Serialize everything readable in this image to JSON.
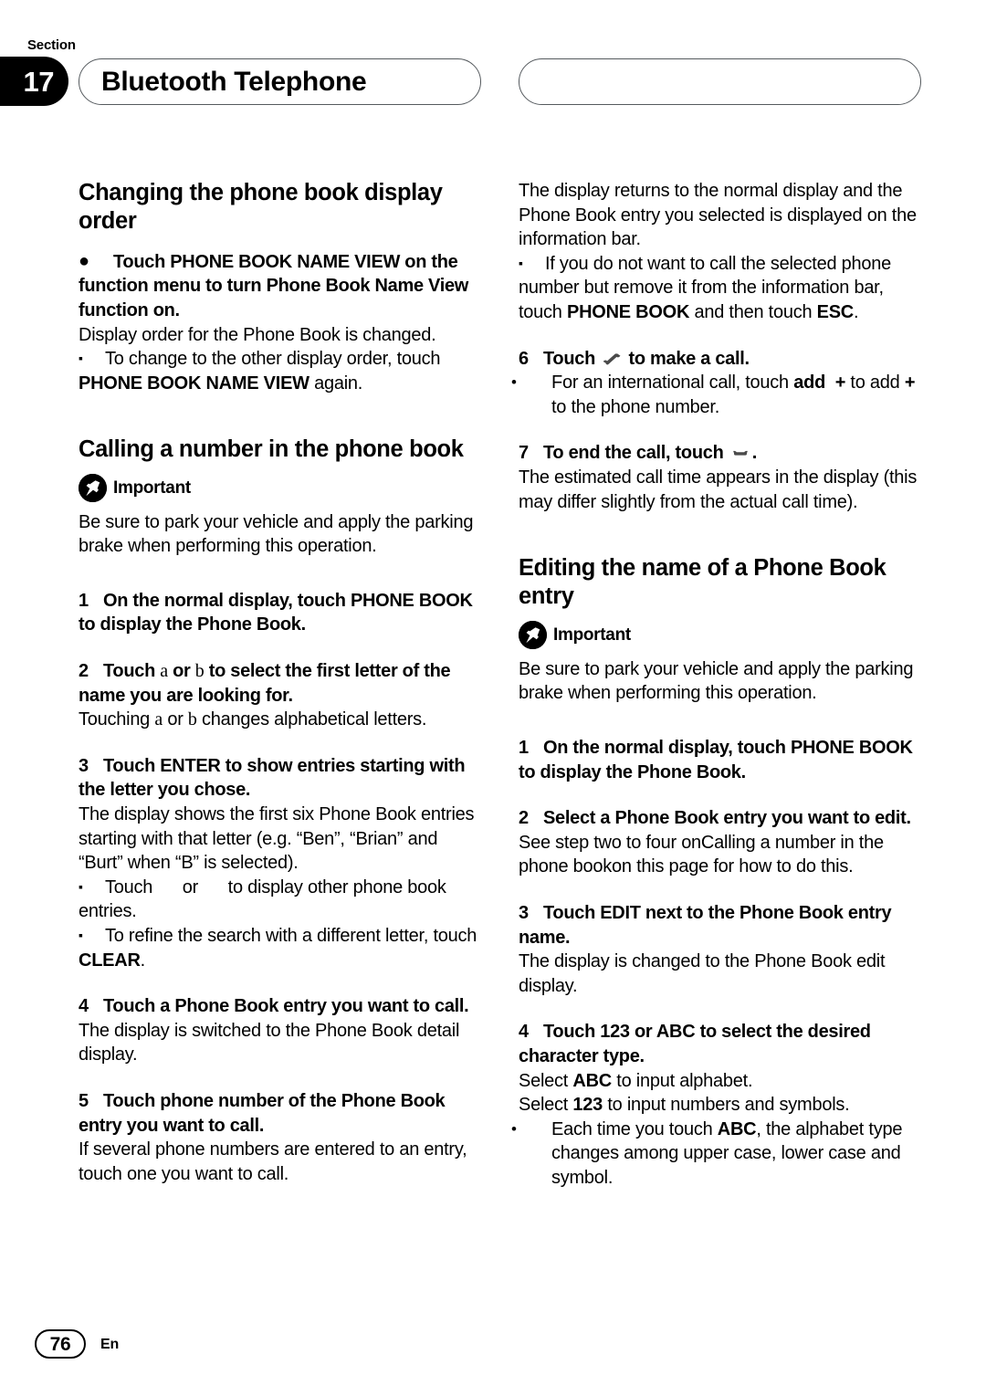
{
  "header": {
    "section_label": "Section",
    "section_number": "17",
    "title": "Bluetooth Telephone"
  },
  "left_column": {
    "heading_1": "Changing the phone book display order",
    "bullet_1_bold": "Touch PHONE BOOK NAME VIEW on the function menu to turn Phone Book Name View function on.",
    "bullet_1_body": "Display order for the Phone Book is changed.",
    "bullet_1_note_a": "To change to the other display order, touch ",
    "bullet_1_note_b": "PHONE BOOK NAME VIEW",
    "bullet_1_note_c": " again.",
    "heading_2": "Calling a number in the phone book",
    "important_label": "Important",
    "important_text": "Be sure to park your vehicle and apply the parking brake when performing this operation.",
    "step_1_num": "1",
    "step_1_text_a": "On the normal display, touch PHONE BOOK to display the Phone Book.",
    "step_2_num": "2",
    "step_2_pre": "Touch ",
    "step_2_sym_a": "a",
    "step_2_mid": " or ",
    "step_2_sym_b": "b",
    "step_2_post": " to select the first letter of the name you are looking for.",
    "step_2_body_pre": "Touching ",
    "step_2_body_sym_a": "a",
    "step_2_body_mid": " or ",
    "step_2_body_sym_b": "b",
    "step_2_body_post": " changes alphabetical letters.",
    "step_3_num": "3",
    "step_3_text": "Touch ENTER to show entries starting with the letter you chose.",
    "step_3_body": "The display shows the first six Phone Book entries starting with that letter (e.g. “Ben”, “Brian” and “Burt” when “B” is selected).",
    "step_3_note_1_a": "Touch ",
    "step_3_note_1_b": " or ",
    "step_3_note_1_c": " to display other phone book entries.",
    "step_3_note_2_a": "To refine the search with a different letter, touch ",
    "step_3_note_2_b": "CLEAR",
    "step_3_note_2_c": ".",
    "step_4_num": "4",
    "step_4_text": "Touch a Phone Book entry you want to call.",
    "step_4_body": "The display is switched to the Phone Book detail display.",
    "step_5_num": "5",
    "step_5_text": "Touch phone number of the Phone Book entry you want to call.",
    "step_5_body": "If several phone numbers are entered to an entry, touch one you want to call."
  },
  "right_column": {
    "intro_body": "The display returns to the normal display and the Phone Book entry you selected is displayed on the information bar.",
    "intro_note_a": "If you do not want to call the selected phone number but remove it from the information bar, touch ",
    "intro_note_b": "PHONE BOOK",
    "intro_note_c": " and then touch ",
    "intro_note_d": "ESC",
    "intro_note_e": ".",
    "step_6_num": "6",
    "step_6_pre": "Touch ",
    "step_6_icon": "phone-handset-offhook-icon",
    "step_6_post": " to make a call.",
    "step_6_sub_a": "For an international call, touch ",
    "step_6_sub_b": "add",
    "step_6_sub_c": "+",
    "step_6_sub_d": " to add ",
    "step_6_sub_e": "+",
    "step_6_sub_f": " to the phone number.",
    "step_7_num": "7",
    "step_7_pre": "To end the call, touch ",
    "step_7_icon": "phone-handset-onhook-icon",
    "step_7_post": ".",
    "step_7_body": "The estimated call time appears in the display (this may differ slightly from the actual call time).",
    "heading_1": "Editing the name of a Phone Book entry",
    "important_label": "Important",
    "important_text": "Be sure to park your vehicle and apply the parking brake when performing this operation.",
    "step_1_num": "1",
    "step_1_text": "On the normal display, touch PHONE BOOK to display the Phone Book.",
    "step_2_num": "2",
    "step_2_text": "Select a Phone Book entry you want to edit.",
    "step_2_body": "See step two to four onCalling a number in the phone bookon this page for how to do this.",
    "step_3_num": "3",
    "step_3_text": "Touch EDIT next to the Phone Book entry name.",
    "step_3_body": "The display is changed to the Phone Book edit display.",
    "step_4_num": "4",
    "step_4_text": "Touch 123 or ABC to select the desired character type.",
    "step_4_body_1_a": "Select ",
    "step_4_body_1_b": "ABC",
    "step_4_body_1_c": " to input alphabet.",
    "step_4_body_2_a": "Select ",
    "step_4_body_2_b": "123",
    "step_4_body_2_c": " to input numbers and symbols.",
    "step_4_sub_a": "Each time you touch ",
    "step_4_sub_b": "ABC",
    "step_4_sub_c": ", the alphabet type changes among upper case, lower case and symbol."
  },
  "footer": {
    "page_number": "76",
    "language": "En"
  },
  "markers": {
    "square": "▪",
    "dot_large": "●",
    "dot_small": "•"
  },
  "colors": {
    "ink": "#000000",
    "pill_border": "#555a5e",
    "paper": "#ffffff"
  }
}
